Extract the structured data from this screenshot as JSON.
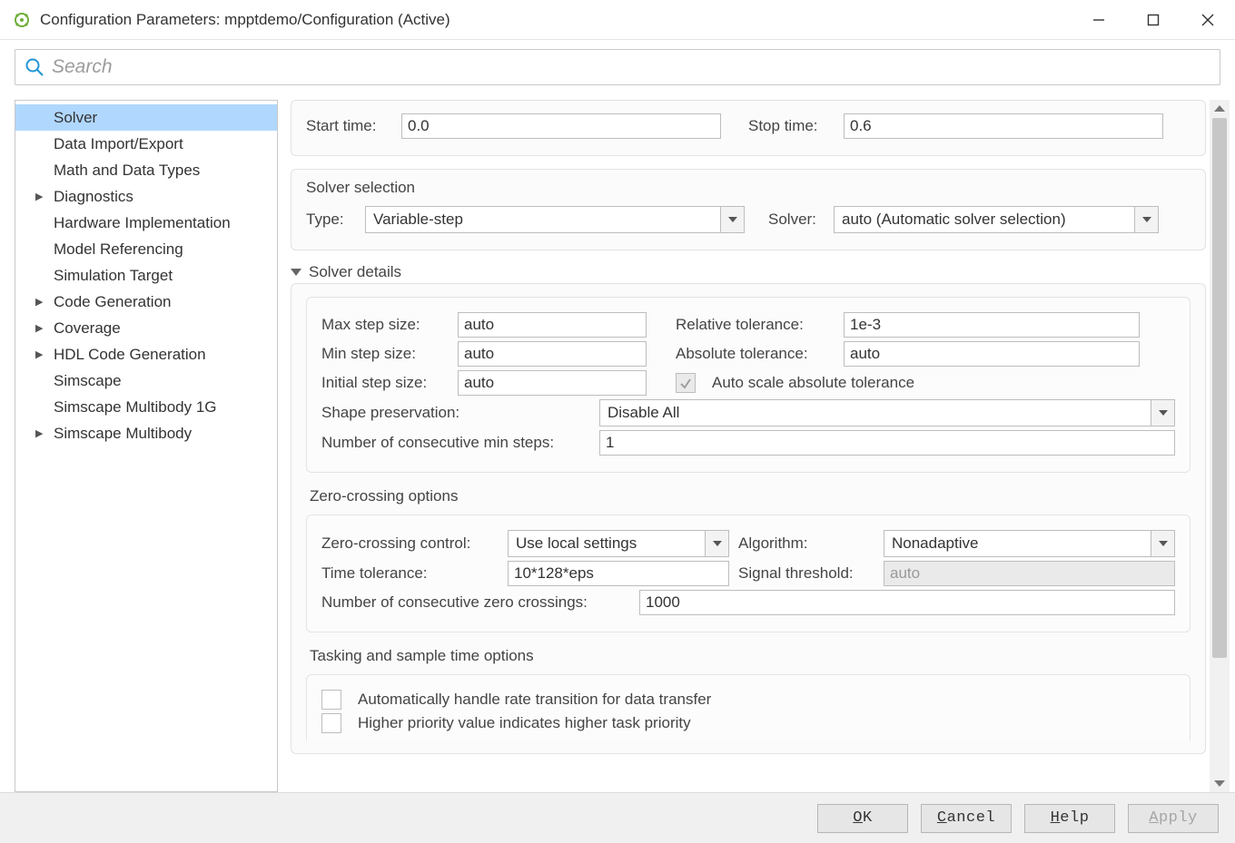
{
  "window": {
    "title": "Configuration Parameters: mpptdemo/Configuration (Active)"
  },
  "search": {
    "placeholder": "Search"
  },
  "sidebar": {
    "items": [
      {
        "label": "Solver",
        "selected": true
      },
      {
        "label": "Data Import/Export"
      },
      {
        "label": "Math and Data Types"
      },
      {
        "label": "Diagnostics",
        "expandable": true
      },
      {
        "label": "Hardware Implementation"
      },
      {
        "label": "Model Referencing"
      },
      {
        "label": "Simulation Target"
      },
      {
        "label": "Code Generation",
        "expandable": true
      },
      {
        "label": "Coverage",
        "expandable": true
      },
      {
        "label": "HDL Code Generation",
        "expandable": true
      },
      {
        "label": "Simscape"
      },
      {
        "label": "Simscape Multibody 1G"
      },
      {
        "label": "Simscape Multibody",
        "expandable": true
      }
    ]
  },
  "simtime": {
    "start_label": "Start time:",
    "start_value": "0.0",
    "stop_label": "Stop time:",
    "stop_value": "0.6"
  },
  "solver_selection": {
    "title": "Solver selection",
    "type_label": "Type:",
    "type_value": "Variable-step",
    "solver_label": "Solver:",
    "solver_value": "auto (Automatic solver selection)"
  },
  "solver_details": {
    "title": "Solver details",
    "max_step_label": "Max step size:",
    "max_step_value": "auto",
    "rel_tol_label": "Relative tolerance:",
    "rel_tol_value": "1e-3",
    "min_step_label": "Min step size:",
    "min_step_value": "auto",
    "abs_tol_label": "Absolute tolerance:",
    "abs_tol_value": "auto",
    "init_step_label": "Initial step size:",
    "init_step_value": "auto",
    "auto_scale_label": "Auto scale absolute tolerance",
    "shape_label": "Shape preservation:",
    "shape_value": "Disable All",
    "min_steps_label": "Number of consecutive min steps:",
    "min_steps_value": "1"
  },
  "zero_crossing": {
    "title": "Zero-crossing options",
    "control_label": "Zero-crossing control:",
    "control_value": "Use local settings",
    "algo_label": "Algorithm:",
    "algo_value": "Nonadaptive",
    "time_tol_label": "Time tolerance:",
    "time_tol_value": "10*128*eps",
    "sig_thresh_label": "Signal threshold:",
    "sig_thresh_value": "auto",
    "consec_label": "Number of consecutive zero crossings:",
    "consec_value": "1000"
  },
  "tasking": {
    "title": "Tasking and sample time options",
    "opt1": "Automatically handle rate transition for data transfer",
    "opt2": "Higher priority value indicates higher task priority"
  },
  "footer": {
    "ok": "OK",
    "cancel": "Cancel",
    "help": "Help",
    "apply": "Apply"
  }
}
